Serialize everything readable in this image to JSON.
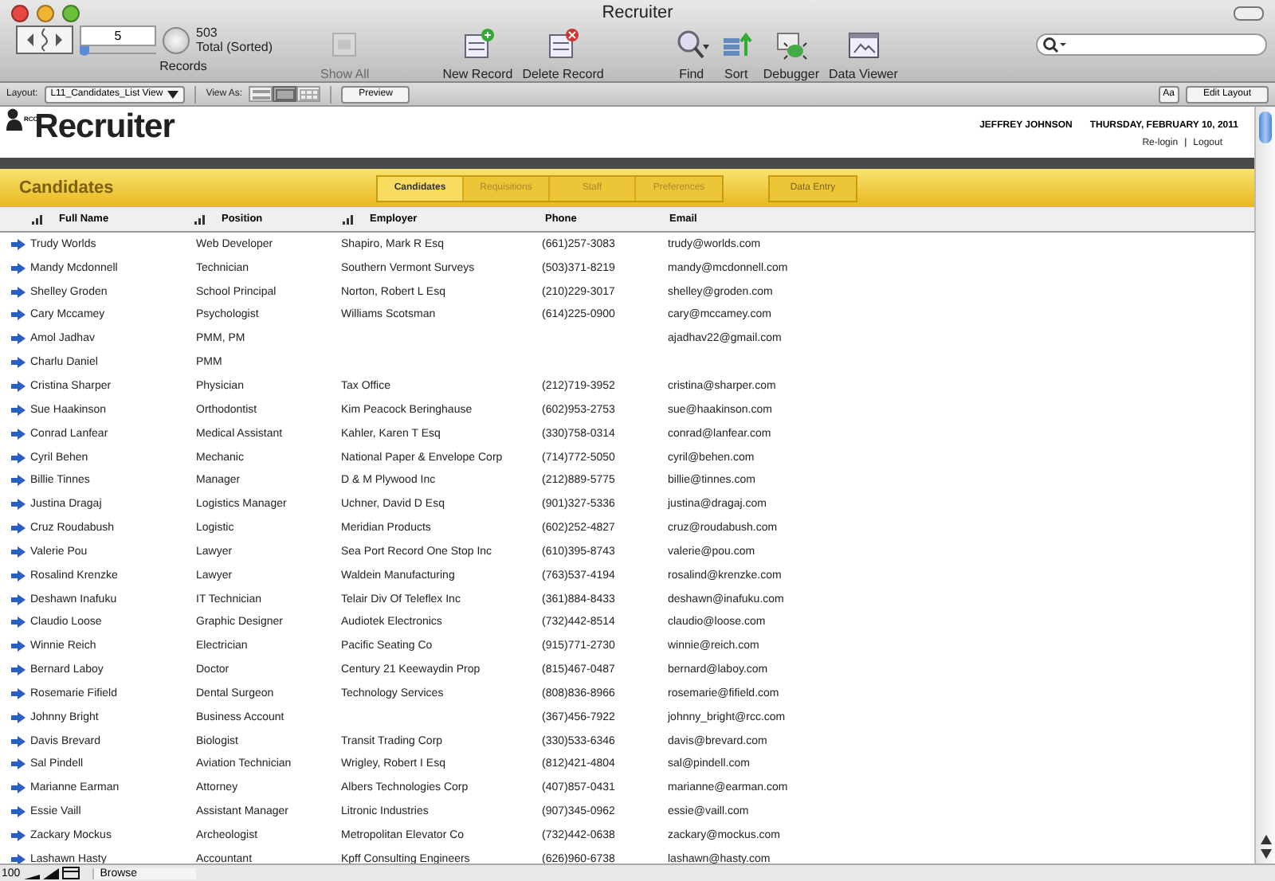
{
  "window": {
    "title": "Recruiter"
  },
  "toolbar": {
    "record_number": "5",
    "records_label": "Records",
    "total": "503",
    "total_note": "Total (Sorted)",
    "level": 0.01,
    "buttons": [
      {
        "label": "Show All",
        "disabled": true
      },
      {
        "label": "New Record",
        "disabled": false
      },
      {
        "label": "Delete Record",
        "disabled": false
      },
      {
        "label": "Find",
        "disabled": false
      },
      {
        "label": "Sort",
        "disabled": false
      },
      {
        "label": "Debugger",
        "disabled": false
      },
      {
        "label": "Data Viewer",
        "disabled": false
      }
    ]
  },
  "layout_bar": {
    "layout_label": "Layout:",
    "layout": "L11_Candidates_List View",
    "view_as_label": "View As:",
    "view_modes": [
      {
        "selected": false
      },
      {
        "selected": true
      },
      {
        "selected": false
      }
    ],
    "preview": "Preview",
    "text_button": "Aa",
    "edit_layout": "Edit Layout"
  },
  "header": {
    "logo": "Recruiter",
    "logo_small": "RCC",
    "user": "JEFFREY JOHNSON",
    "date": "THURSDAY, FEBRUARY 10, 2011",
    "relogin": "Re-login",
    "separator": "|",
    "logout": "Logout"
  },
  "band": {
    "title": "Candidates",
    "tabs": [
      {
        "label": "Candidates",
        "selected": true
      },
      {
        "label": "Requisitions",
        "selected": false
      },
      {
        "label": "Staff",
        "selected": false
      },
      {
        "label": "Preferences",
        "selected": false
      }
    ],
    "data_entry": "Data Entry"
  },
  "table": {
    "columns": [
      {
        "label": "Full Name",
        "sortable": true
      },
      {
        "label": "Position",
        "sortable": true
      },
      {
        "label": "Employer",
        "sortable": true
      },
      {
        "label": "Phone",
        "sortable": false
      },
      {
        "label": "Email",
        "sortable": false
      }
    ],
    "rows": [
      {
        "name": "Trudy Worlds",
        "position": "Web Developer",
        "employer": "Shapiro, Mark R Esq",
        "phone": "(661)257-3083",
        "email": "trudy@worlds.com"
      },
      {
        "name": "Mandy Mcdonnell",
        "position": "Technician",
        "employer": "Southern Vermont Surveys",
        "phone": "(503)371-8219",
        "email": "mandy@mcdonnell.com"
      },
      {
        "name": "Shelley Groden",
        "position": "School Principal",
        "employer": "Norton, Robert L Esq",
        "phone": "(210)229-3017",
        "email": "shelley@groden.com"
      },
      {
        "name": "Cary Mccamey",
        "position": "Psychologist",
        "employer": "Williams Scotsman",
        "phone": "(614)225-0900",
        "email": "cary@mccamey.com"
      },
      {
        "name": "Amol Jadhav",
        "position": "PMM, PM",
        "email": "ajadhav22@gmail.com"
      },
      {
        "name": "Charlu Daniel",
        "position": "PMM"
      },
      {
        "name": "Cristina Sharper",
        "position": "Physician",
        "employer": "Tax Office",
        "phone": "(212)719-3952",
        "email": "cristina@sharper.com"
      },
      {
        "name": "Sue Haakinson",
        "position": "Orthodontist",
        "employer": "Kim Peacock Beringhause",
        "phone": "(602)953-2753",
        "email": "sue@haakinson.com"
      },
      {
        "name": "Conrad Lanfear",
        "position": "Medical Assistant",
        "employer": "Kahler, Karen T Esq",
        "phone": "(330)758-0314",
        "email": "conrad@lanfear.com"
      },
      {
        "name": "Cyril Behen",
        "position": "Mechanic",
        "employer": "National Paper & Envelope Corp",
        "phone": "(714)772-5050",
        "email": "cyril@behen.com"
      },
      {
        "name": "Billie Tinnes",
        "position": "Manager",
        "employer": "D & M Plywood Inc",
        "phone": "(212)889-5775",
        "email": "billie@tinnes.com"
      },
      {
        "name": "Justina Dragaj",
        "position": "Logistics Manager",
        "employer": "Uchner, David D Esq",
        "phone": "(901)327-5336",
        "email": "justina@dragaj.com"
      },
      {
        "name": "Cruz Roudabush",
        "position": "Logistic",
        "employer": "Meridian Products",
        "phone": "(602)252-4827",
        "email": "cruz@roudabush.com"
      },
      {
        "name": "Valerie Pou",
        "position": "Lawyer",
        "employer": "Sea Port Record One Stop Inc",
        "phone": "(610)395-8743",
        "email": "valerie@pou.com"
      },
      {
        "name": "Rosalind Krenzke",
        "position": "Lawyer",
        "employer": "Waldein Manufacturing",
        "phone": "(763)537-4194",
        "email": "rosalind@krenzke.com"
      },
      {
        "name": "Deshawn Inafuku",
        "position": "IT Technician",
        "employer": "Telair Div Of Teleflex Inc",
        "phone": "(361)884-8433",
        "email": "deshawn@inafuku.com"
      },
      {
        "name": "Claudio Loose",
        "position": "Graphic Designer",
        "employer": "Audiotek Electronics",
        "phone": "(732)442-8514",
        "email": "claudio@loose.com"
      },
      {
        "name": "Winnie Reich",
        "position": "Electrician",
        "employer": "Pacific Seating Co",
        "phone": "(915)771-2730",
        "email": "winnie@reich.com"
      },
      {
        "name": "Bernard Laboy",
        "position": "Doctor",
        "employer": "Century 21 Keewaydin Prop",
        "phone": "(815)467-0487",
        "email": "bernard@laboy.com"
      },
      {
        "name": "Rosemarie Fifield",
        "position": "Dental Surgeon",
        "employer": "Technology Services",
        "phone": "(808)836-8966",
        "email": "rosemarie@fifield.com"
      },
      {
        "name": "Johnny Bright",
        "position": "Business Account",
        "phone": "(367)456-7922",
        "email": "johnny_bright@rcc.com"
      },
      {
        "name": "Davis Brevard",
        "position": "Biologist",
        "employer": "Transit Trading Corp",
        "phone": "(330)533-6346",
        "email": "davis@brevard.com"
      },
      {
        "name": "Sal Pindell",
        "position": "Aviation Technician",
        "employer": "Wrigley, Robert I Esq",
        "phone": "(812)421-4804",
        "email": "sal@pindell.com"
      },
      {
        "name": "Marianne Earman",
        "position": "Attorney",
        "employer": "Albers Technologies Corp",
        "phone": "(407)857-0431",
        "email": "marianne@earman.com"
      },
      {
        "name": "Essie Vaill",
        "position": "Assistant Manager",
        "employer": "Litronic Industries",
        "phone": "(907)345-0962",
        "email": "essie@vaill.com"
      },
      {
        "name": "Zackary Mockus",
        "position": "Archeologist",
        "employer": "Metropolitan Elevator Co",
        "phone": "(732)442-0638",
        "email": "zackary@mockus.com"
      },
      {
        "name": "Lashawn Hasty",
        "position": "Accountant",
        "employer": "Kpff Consulting Engineers",
        "phone": "(626)960-6738",
        "email": "lashawn@hasty.com"
      }
    ]
  },
  "status_bar": {
    "zoom": "100",
    "mode": "Browse"
  }
}
